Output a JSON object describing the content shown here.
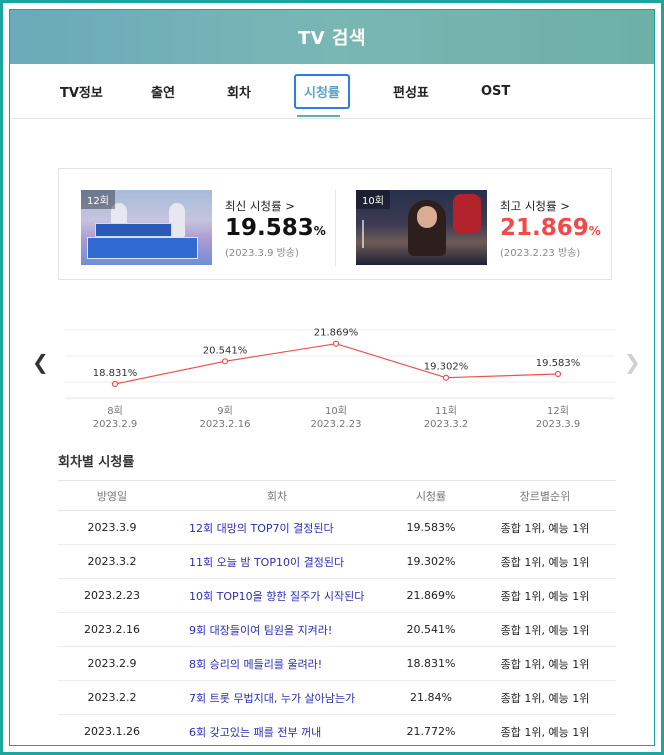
{
  "header": {
    "title": "TV 검색"
  },
  "tabs": [
    {
      "label": "TV정보"
    },
    {
      "label": "출연"
    },
    {
      "label": "회차"
    },
    {
      "label": "시청률",
      "active": true
    },
    {
      "label": "편성표"
    },
    {
      "label": "OST"
    }
  ],
  "summary": {
    "latest": {
      "badge": "12회",
      "label": "최신 시청률 >",
      "value": "19.583",
      "unit": "%",
      "date": "(2023.3.9 방송)"
    },
    "highest": {
      "badge": "10회",
      "label": "최고 시청률 >",
      "value": "21.869",
      "unit": "%",
      "date": "(2023.2.23 방송)"
    }
  },
  "colors": {
    "accent": "#5fb0a5",
    "line": "#f05050",
    "red": "#f04a4a",
    "link": "#2b2fb0",
    "active_tab_border": "#2b7de9"
  },
  "icons": {
    "prev": "chevron-left-icon",
    "next": "chevron-right-icon"
  },
  "chart_data": {
    "type": "line",
    "categories": [
      "8회",
      "9회",
      "10회",
      "11회",
      "12회"
    ],
    "dates": [
      "2023.2.9",
      "2023.2.16",
      "2023.2.23",
      "2023.3.2",
      "2023.3.9"
    ],
    "values": [
      18.831,
      20.541,
      21.869,
      19.302,
      19.583
    ],
    "value_labels": [
      "18.831%",
      "20.541%",
      "21.869%",
      "19.302%",
      "19.583%"
    ],
    "grid": true
  },
  "ratings_table": {
    "title": "회차별 시청률",
    "columns": [
      "방영일",
      "회차",
      "시청률",
      "장르별순위"
    ],
    "rows": [
      {
        "date": "2023.3.9",
        "episode": "12회 대망의 TOP7이 결정된다",
        "rating": "19.583%",
        "rank": "종합 1위, 예능 1위"
      },
      {
        "date": "2023.3.2",
        "episode": "11회 오늘 밤 TOP10이 결정된다",
        "rating": "19.302%",
        "rank": "종합 1위, 예능 1위"
      },
      {
        "date": "2023.2.23",
        "episode": "10회 TOP10을 향한 질주가 시작된다",
        "rating": "21.869%",
        "rank": "종합 1위, 예능 1위"
      },
      {
        "date": "2023.2.16",
        "episode": "9회 대장들이여 팀원을 지켜라!",
        "rating": "20.541%",
        "rank": "종합 1위, 예능 1위"
      },
      {
        "date": "2023.2.9",
        "episode": "8회 승리의 메들리를 울려라!",
        "rating": "18.831%",
        "rank": "종합 1위, 예능 1위"
      },
      {
        "date": "2023.2.2",
        "episode": "7회 트롯 무법지대, 누가 살아남는가",
        "rating": "21.84%",
        "rank": "종합 1위, 예능 1위"
      },
      {
        "date": "2023.1.26",
        "episode": "6회 갖고있는 패를 전부 꺼내",
        "rating": "21.772%",
        "rank": "종합 1위, 예능 1위"
      }
    ]
  }
}
